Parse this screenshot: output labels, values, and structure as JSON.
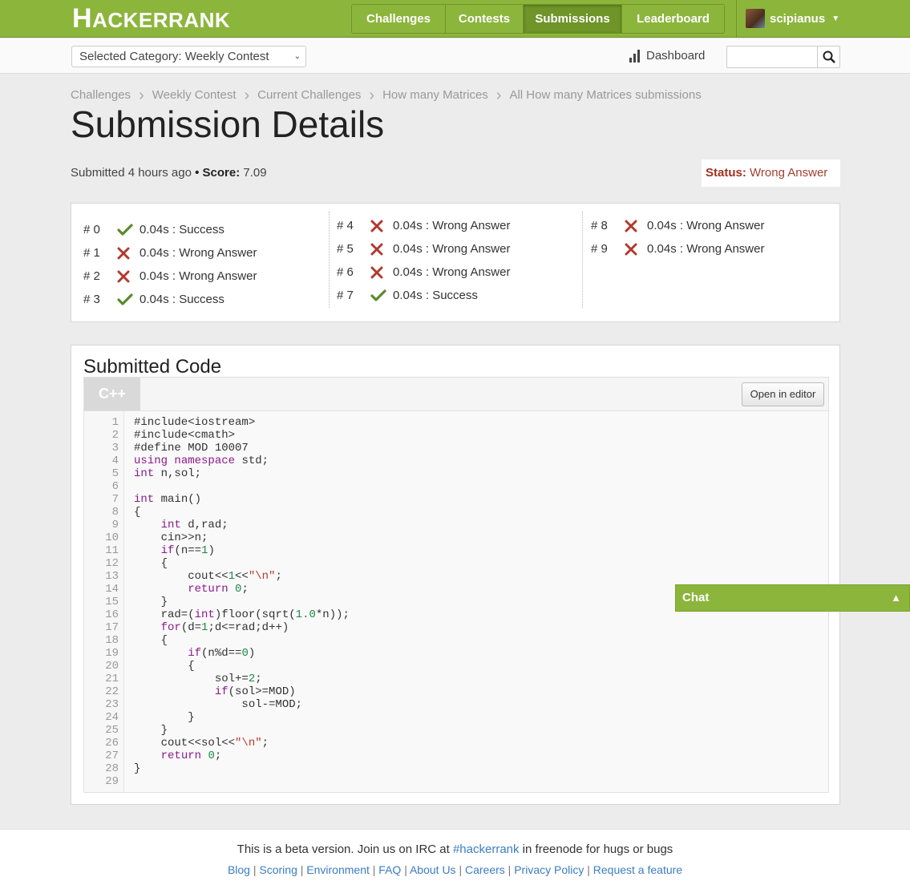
{
  "brand": {
    "logo_text": "HACKERRANK",
    "accent": "#8cb53c",
    "accent_dark": "#6f9428"
  },
  "nav": {
    "items": [
      {
        "label": "Challenges"
      },
      {
        "label": "Contests"
      },
      {
        "label": "Submissions",
        "active": true
      },
      {
        "label": "Leaderboard"
      }
    ],
    "user": "scipianus"
  },
  "subbar": {
    "category": "Selected Category: Weekly Contest",
    "dashboard": "Dashboard",
    "search_placeholder": ""
  },
  "breadcrumb": [
    "Challenges",
    "Weekly Contest",
    "Current Challenges",
    "How many Matrices",
    "All How many Matrices submissions"
  ],
  "page": {
    "title": "Submission Details",
    "submitted": "Submitted 4 hours ago",
    "bullet": "•",
    "score_label": "Score:",
    "score_value": "7.09",
    "status_label": "Status:",
    "status_value": "Wrong Answer"
  },
  "testcases": [
    {
      "num": "# 0",
      "result": "success",
      "text": "0.04s : Success"
    },
    {
      "num": "# 1",
      "result": "fail",
      "text": "0.04s : Wrong Answer"
    },
    {
      "num": "# 2",
      "result": "fail",
      "text": "0.04s : Wrong Answer"
    },
    {
      "num": "# 3",
      "result": "success",
      "text": "0.04s : Success"
    },
    {
      "num": "# 4",
      "result": "fail",
      "text": "0.04s : Wrong Answer"
    },
    {
      "num": "# 5",
      "result": "fail",
      "text": "0.04s : Wrong Answer"
    },
    {
      "num": "# 6",
      "result": "fail",
      "text": "0.04s : Wrong Answer"
    },
    {
      "num": "# 7",
      "result": "success",
      "text": "0.04s : Success"
    },
    {
      "num": "# 8",
      "result": "fail",
      "text": "0.04s : Wrong Answer"
    },
    {
      "num": "# 9",
      "result": "fail",
      "text": "0.04s : Wrong Answer"
    }
  ],
  "code": {
    "heading": "Submitted Code",
    "language": "C++",
    "open_editor": "Open in editor",
    "lines": [
      "#include<iostream>",
      "#include<cmath>",
      "#define MOD 10007",
      "using namespace std;",
      "int n,sol;",
      "",
      "int main()",
      "{",
      "    int d,rad;",
      "    cin>>n;",
      "    if(n==1)",
      "    {",
      "        cout<<1<<\"\\n\";",
      "        return 0;",
      "    }",
      "    rad=(int)floor(sqrt(1.0*n));",
      "    for(d=1;d<=rad;d++)",
      "    {",
      "        if(n%d==0)",
      "        {",
      "            sol+=2;",
      "            if(sol>=MOD)",
      "                sol-=MOD;",
      "        }",
      "    }",
      "    cout<<sol<<\"\\n\";",
      "    return 0;",
      "}",
      ""
    ]
  },
  "chat": {
    "label": "Chat"
  },
  "footer": {
    "note_before": "This is a beta version. Join us on IRC at ",
    "note_link": "#hackerrank",
    "note_after": " in freenode for hugs or bugs",
    "links": [
      "Blog",
      "Scoring",
      "Environment",
      "FAQ",
      "About Us",
      "Careers",
      "Privacy Policy",
      "Request a feature"
    ]
  },
  "colors": {
    "success": "#5a8a2a",
    "fail": "#b03a2e",
    "link": "#3b7dc4"
  }
}
